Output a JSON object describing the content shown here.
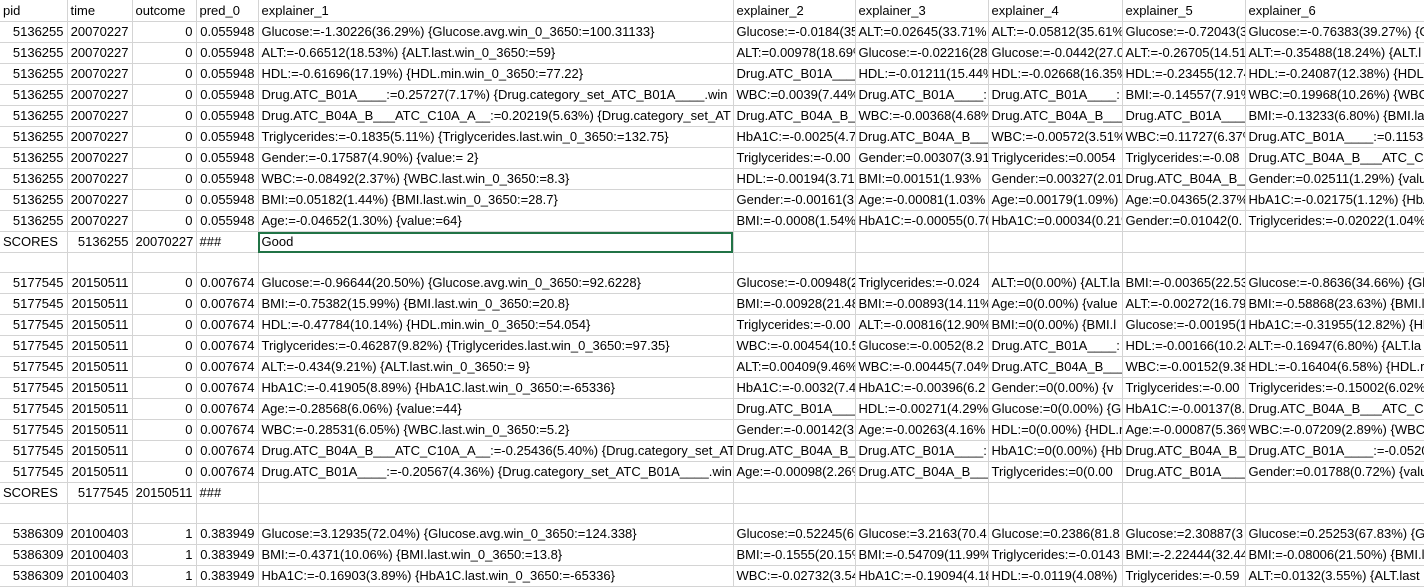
{
  "columns": [
    "pid",
    "time",
    "outcome",
    "pred_0",
    "explainer_1",
    "explainer_2",
    "explainer_3",
    "explainer_4",
    "explainer_5",
    "explainer_6"
  ],
  "rows": [
    [
      "5136255",
      "20070227",
      "0",
      "0.055948",
      "Glucose:=-1.30226(36.29%) {Glucose.avg.win_0_3650:=100.31133}",
      "Glucose:=-0.0184(35",
      "ALT:=0.02645(33.71%",
      "ALT:=-0.05812(35.61%",
      "Glucose:=-0.72043(3",
      "Glucose:=-0.76383(39.27%) {G"
    ],
    [
      "5136255",
      "20070227",
      "0",
      "0.055948",
      "ALT:=-0.66512(18.53%) {ALT.last.win_0_3650:=59}",
      "ALT:=0.00978(18.69%",
      "Glucose:=-0.02216(28",
      "Glucose:=-0.0442(27.0",
      "ALT:=-0.26705(14.51%",
      "ALT:=-0.35488(18.24%) {ALT.l"
    ],
    [
      "5136255",
      "20070227",
      "0",
      "0.055948",
      "HDL:=-0.61696(17.19%) {HDL.min.win_0_3650:=77.22}",
      "Drug.ATC_B01A____",
      "HDL:=-0.01211(15.44%",
      "HDL:=-0.02668(16.35%",
      "HDL:=-0.23455(12.74",
      "HDL:=-0.24087(12.38%) {HDL.m"
    ],
    [
      "5136255",
      "20070227",
      "0",
      "0.055948",
      "Drug.ATC_B01A____:=0.25727(7.17%) {Drug.category_set_ATC_B01A____.win",
      "WBC:=0.0039(7.44%",
      "Drug.ATC_B01A____:",
      "Drug.ATC_B01A____:",
      "BMI:=-0.14557(7.91%",
      "WBC:=0.19968(10.26%) {WBC"
    ],
    [
      "5136255",
      "20070227",
      "0",
      "0.055948",
      "Drug.ATC_B04A_B___ATC_C10A_A__:=0.20219(5.63%) {Drug.category_set_AT",
      "Drug.ATC_B04A_B_",
      "WBC:=-0.00368(4.68%",
      "Drug.ATC_B04A_B___",
      "Drug.ATC_B01A____",
      "BMI:=-0.13233(6.80%) {BMI.la"
    ],
    [
      "5136255",
      "20070227",
      "0",
      "0.055948",
      "Triglycerides:=-0.1835(5.11%) {Triglycerides.last.win_0_3650:=132.75}",
      "HbA1C:=-0.0025(4.7",
      "Drug.ATC_B04A_B___",
      "WBC:=-0.00572(3.51%",
      "WBC:=0.11727(6.37%",
      "Drug.ATC_B01A____:=0.11538"
    ],
    [
      "5136255",
      "20070227",
      "0",
      "0.055948",
      "Gender:=-0.17587(4.90%) {value:= 2}",
      "Triglycerides:=-0.00",
      "Gender:=0.00307(3.91",
      "Triglycerides:=0.0054",
      "Triglycerides:=-0.08",
      "Drug.ATC_B04A_B___ATC_C1"
    ],
    [
      "5136255",
      "20070227",
      "0",
      "0.055948",
      "WBC:=-0.08492(2.37%) {WBC.last.win_0_3650:=8.3}",
      "HDL:=-0.00194(3.71%",
      "BMI:=0.00151(1.93%",
      "Gender:=0.00327(2.01",
      "Drug.ATC_B04A_B___",
      "Gender:=0.02511(1.29%) {valu"
    ],
    [
      "5136255",
      "20070227",
      "0",
      "0.055948",
      "BMI:=0.05182(1.44%) {BMI.last.win_0_3650:=28.7}",
      "Gender:=-0.00161(3",
      "Age:=-0.00081(1.03%",
      "Age:=0.00179(1.09%)",
      "Age:=0.04365(2.37%",
      "HbA1C:=-0.02175(1.12%) {HbA"
    ],
    [
      "5136255",
      "20070227",
      "0",
      "0.055948",
      "Age:=-0.04652(1.30%) {value:=64}",
      "BMI:=-0.0008(1.54%",
      "HbA1C:=-0.00055(0.70",
      "HbA1C:=0.00034(0.21%",
      "Gender:=0.01042(0.",
      "Triglycerides:=-0.02022(1.04%"
    ],
    [
      "SCORES",
      "5136255",
      "20070227",
      "###",
      "Good",
      "",
      "",
      "",
      "",
      ""
    ],
    [
      "",
      "",
      "",
      "",
      "",
      "",
      "",
      "",
      "",
      ""
    ],
    [
      "5177545",
      "20150511",
      "0",
      "0.007674",
      "Glucose:=-0.96644(20.50%) {Glucose.avg.win_0_3650:=92.6228}",
      "Glucose:=-0.00948(2",
      "Triglycerides:=-0.024",
      "ALT:=0(0.00%) {ALT.la",
      "BMI:=-0.00365(22.53",
      "Glucose:=-0.8636(34.66%) {Gl"
    ],
    [
      "5177545",
      "20150511",
      "0",
      "0.007674",
      "BMI:=-0.75382(15.99%) {BMI.last.win_0_3650:=20.8}",
      "BMI:=-0.00928(21.48",
      "BMI:=-0.00893(14.11%",
      "Age:=0(0.00%) {value",
      "ALT:=-0.00272(16.79",
      "BMI:=-0.58868(23.63%) {BMI.l"
    ],
    [
      "5177545",
      "20150511",
      "0",
      "0.007674",
      "HDL:=-0.47784(10.14%) {HDL.min.win_0_3650:=54.054}",
      "Triglycerides:=-0.00",
      "ALT:=-0.00816(12.90%",
      "BMI:=0(0.00%) {BMI.l",
      "Glucose:=-0.00195(1",
      "HbA1C:=-0.31955(12.82%) {Hb"
    ],
    [
      "5177545",
      "20150511",
      "0",
      "0.007674",
      "Triglycerides:=-0.46287(9.82%) {Triglycerides.last.win_0_3650:=97.35}",
      "WBC:=-0.00454(10.5",
      "Glucose:=-0.0052(8.2",
      "Drug.ATC_B01A____:",
      "HDL:=-0.00166(10.24",
      "ALT:=-0.16947(6.80%) {ALT.la"
    ],
    [
      "5177545",
      "20150511",
      "0",
      "0.007674",
      "ALT:=-0.434(9.21%) {ALT.last.win_0_3650:= 9}",
      "ALT:=0.00409(9.46%",
      "WBC:=-0.00445(7.04%",
      "Drug.ATC_B04A_B___",
      "WBC:=-0.00152(9.38",
      "HDL:=-0.16404(6.58%) {HDL.mi"
    ],
    [
      "5177545",
      "20150511",
      "0",
      "0.007674",
      "HbA1C:=-0.41905(8.89%) {HbA1C.last.win_0_3650:=-65336}",
      "HbA1C:=-0.0032(7.4",
      "HbA1C:=-0.00396(6.2",
      "Gender:=0(0.00%) {v",
      "Triglycerides:=-0.00",
      "Triglycerides:=-0.15002(6.02%"
    ],
    [
      "5177545",
      "20150511",
      "0",
      "0.007674",
      "Age:=-0.28568(6.06%) {value:=44}",
      "Drug.ATC_B01A____",
      "HDL:=-0.00271(4.29%",
      "Glucose:=0(0.00%) {G",
      "HbA1C:=-0.00137(8.",
      "Drug.ATC_B04A_B___ATC_C1"
    ],
    [
      "5177545",
      "20150511",
      "0",
      "0.007674",
      "WBC:=-0.28531(6.05%) {WBC.last.win_0_3650:=5.2}",
      "Gender:=-0.00142(3",
      "Age:=-0.00263(4.16%",
      "HDL:=0(0.00%) {HDL.m",
      "Age:=-0.00087(5.36%",
      "WBC:=-0.07209(2.89%) {WBC."
    ],
    [
      "5177545",
      "20150511",
      "0",
      "0.007674",
      "Drug.ATC_B04A_B___ATC_C10A_A__:=-0.25436(5.40%) {Drug.category_set_AT",
      "Drug.ATC_B04A_B_",
      "Drug.ATC_B01A____:",
      "HbA1C:=0(0.00%) {Hb",
      "Drug.ATC_B04A_B___",
      "Drug.ATC_B01A____:=-0.0520"
    ],
    [
      "5177545",
      "20150511",
      "0",
      "0.007674",
      "Drug.ATC_B01A____:=-0.20567(4.36%) {Drug.category_set_ATC_B01A____.win",
      "Age:=-0.00098(2.26%",
      "Drug.ATC_B04A_B___",
      "Triglycerides:=0(0.00",
      "Drug.ATC_B01A____",
      "Gender:=0.01788(0.72%) {valu"
    ],
    [
      "SCORES",
      "5177545",
      "20150511",
      "###",
      "",
      "",
      "",
      "",
      "",
      ""
    ],
    [
      "",
      "",
      "",
      "",
      "",
      "",
      "",
      "",
      "",
      ""
    ],
    [
      "5386309",
      "20100403",
      "1",
      "0.383949",
      "Glucose:=3.12935(72.04%) {Glucose.avg.win_0_3650:=124.338}",
      "Glucose:=0.52245(6",
      "Glucose:=3.2163(70.4",
      "Glucose:=0.2386(81.8",
      "Glucose:=2.30887(3",
      "Glucose:=0.25253(67.83%) {G"
    ],
    [
      "5386309",
      "20100403",
      "1",
      "0.383949",
      "BMI:=-0.4371(10.06%) {BMI.last.win_0_3650:=13.8}",
      "BMI:=-0.1555(20.15%",
      "BMI:=-0.54709(11.99%",
      "Triglycerides:=-0.0143",
      "BMI:=-2.22444(32.44",
      "BMI:=-0.08006(21.50%) {BMI.l"
    ],
    [
      "5386309",
      "20100403",
      "1",
      "0.383949",
      "HbA1C:=-0.16903(3.89%) {HbA1C.last.win_0_3650:=-65336}",
      "WBC:=-0.02732(3.54",
      "HbA1C:=-0.19094(4.18",
      "HDL:=-0.0119(4.08%)",
      "Triglycerides:=-0.59",
      "ALT:=0.0132(3.55%) {ALT.last"
    ]
  ]
}
